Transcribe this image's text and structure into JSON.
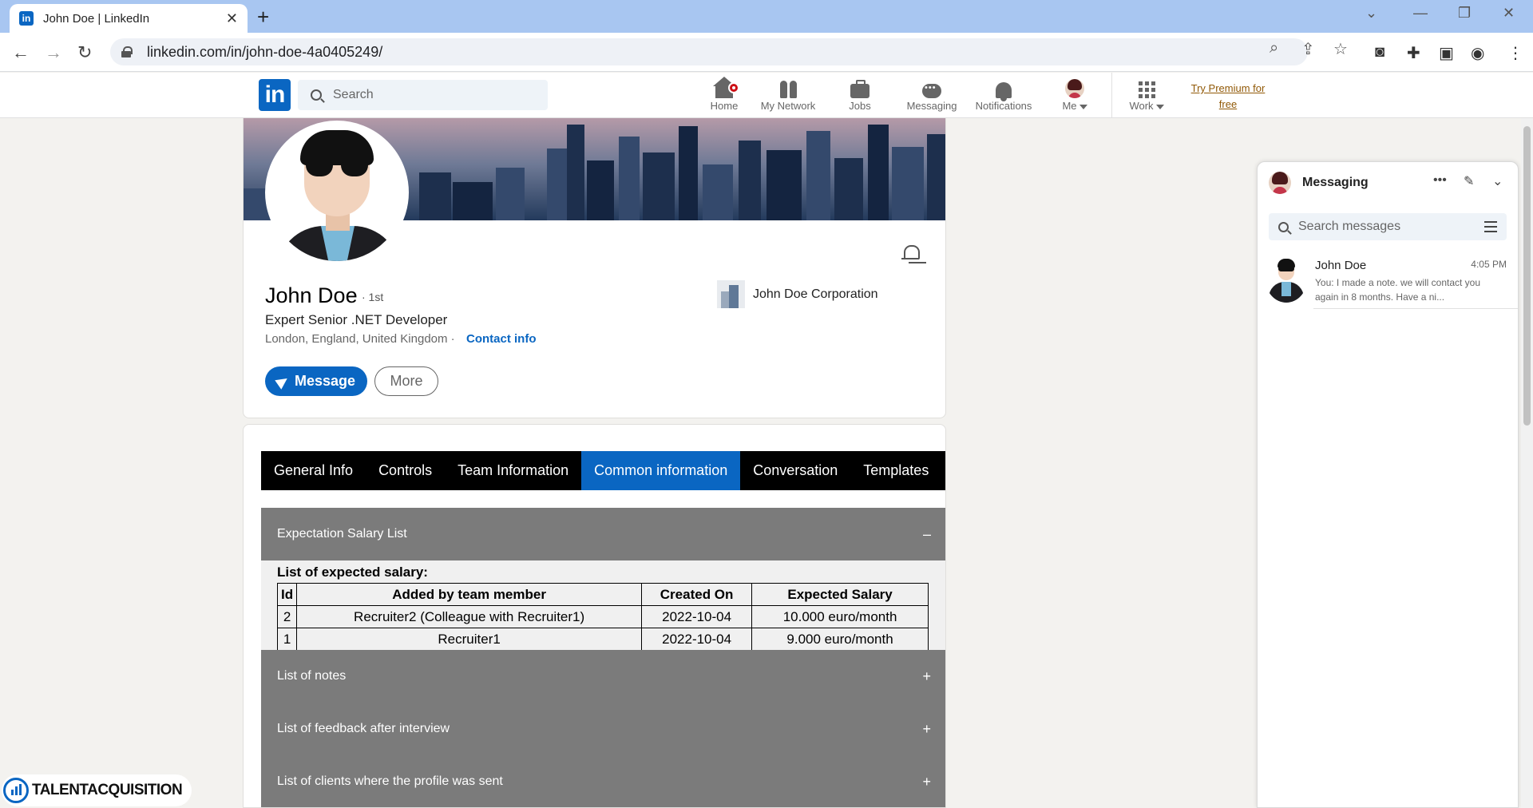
{
  "browser": {
    "tab_title": "John Doe | LinkedIn",
    "url": "linkedin.com/in/john-doe-4a0405249/",
    "tab_favicon": "in"
  },
  "header": {
    "logo_text": "in",
    "search_placeholder": "Search",
    "nav": [
      {
        "label": "Home",
        "icon": "home-icon"
      },
      {
        "label": "My Network",
        "icon": "network-icon"
      },
      {
        "label": "Jobs",
        "icon": "briefcase-icon"
      },
      {
        "label": "Messaging",
        "icon": "chat-icon"
      },
      {
        "label": "Notifications",
        "icon": "bell-icon"
      },
      {
        "label": "Me",
        "icon": "avatar"
      },
      {
        "label": "Work",
        "icon": "grid-icon"
      }
    ],
    "premium_line1": "Try Premium for",
    "premium_line2": "free"
  },
  "profile": {
    "name": "John Doe",
    "degree": "· 1st",
    "headline": "Expert Senior .NET Developer",
    "location": "London, England, United Kingdom ·",
    "contact_info": "Contact info",
    "company": "John Doe Corporation",
    "message_label": "Message",
    "more_label": "More"
  },
  "extension": {
    "tabs": [
      {
        "label": "General Info",
        "active": false
      },
      {
        "label": "Controls",
        "active": false
      },
      {
        "label": "Team Information",
        "active": false
      },
      {
        "label": "Common information",
        "active": true
      },
      {
        "label": "Conversation",
        "active": false
      },
      {
        "label": "Templates",
        "active": false
      }
    ],
    "sections": [
      {
        "title": "Expectation Salary List",
        "toggle": "–"
      },
      {
        "title": "List of notes",
        "toggle": "+"
      },
      {
        "title": "List of feedback after interview",
        "toggle": "+"
      },
      {
        "title": "List of clients where the profile was sent",
        "toggle": "+"
      }
    ],
    "salary": {
      "caption": "List of expected salary:",
      "columns": [
        "Id",
        "Added by team member",
        "Created On",
        "Expected Salary"
      ],
      "rows": [
        [
          "2",
          "Recruiter2 (Colleague with Recruiter1)",
          "2022-10-04",
          "10.000 euro/month"
        ],
        [
          "1",
          "Recruiter1",
          "2022-10-04",
          "9.000 euro/month"
        ]
      ]
    }
  },
  "messaging": {
    "title": "Messaging",
    "search_placeholder": "Search messages",
    "conversations": [
      {
        "name": "John Doe",
        "time": "4:05 PM",
        "preview": "You: I made a note. we will contact you again in 8 months. Have a ni..."
      }
    ]
  },
  "watermark": {
    "text": "TALENTACQUISITION"
  },
  "colors": {
    "linkedin_blue": "#0a66c2",
    "premium_gold": "#915907",
    "accordion_gray": "#7b7b7b",
    "tab_bar_black": "#000000"
  }
}
